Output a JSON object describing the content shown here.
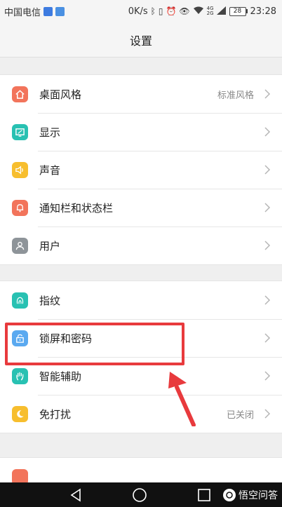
{
  "status_bar": {
    "carrier": "中国电信",
    "speed": "0K/s",
    "network": "4G",
    "network2": "2G",
    "battery": "28",
    "time": "23:28"
  },
  "header": {
    "title": "设置"
  },
  "groups": [
    {
      "items": [
        {
          "label": "桌面风格",
          "value": "标准风格",
          "icon": "home-icon",
          "color": "#f2745b"
        },
        {
          "label": "显示",
          "value": "",
          "icon": "display-icon",
          "color": "#28c1b2"
        },
        {
          "label": "声音",
          "value": "",
          "icon": "speaker-icon",
          "color": "#f7be2e"
        },
        {
          "label": "通知栏和状态栏",
          "value": "",
          "icon": "bell-icon",
          "color": "#f2745b"
        },
        {
          "label": "用户",
          "value": "",
          "icon": "user-icon",
          "color": "#8e9499"
        }
      ]
    },
    {
      "items": [
        {
          "label": "指纹",
          "value": "",
          "icon": "fingerprint-icon",
          "color": "#28c1b2"
        },
        {
          "label": "锁屏和密码",
          "value": "",
          "icon": "lock-icon",
          "color": "#5aa9f0"
        },
        {
          "label": "智能辅助",
          "value": "",
          "icon": "hand-icon",
          "color": "#28c1b2"
        },
        {
          "label": "免打扰",
          "value": "已关闭",
          "icon": "moon-icon",
          "color": "#f7be2e"
        }
      ]
    }
  ],
  "colors": {
    "highlight": "#e83a3d",
    "accent_red": "#f2745b",
    "accent_teal": "#28c1b2",
    "accent_yellow": "#f7be2e"
  },
  "watermark": {
    "text": "悟空问答"
  }
}
